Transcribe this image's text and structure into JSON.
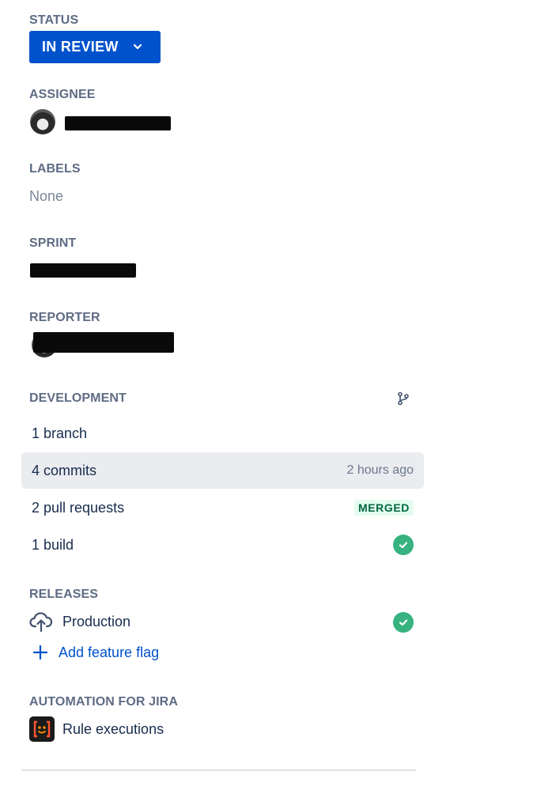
{
  "status": {
    "label": "STATUS",
    "value": "IN REVIEW",
    "color": "#0052cc"
  },
  "assignee": {
    "label": "ASSIGNEE"
  },
  "labels": {
    "label": "LABELS",
    "value": "None"
  },
  "sprint": {
    "label": "SPRINT"
  },
  "reporter": {
    "label": "REPORTER"
  },
  "development": {
    "label": "DEVELOPMENT",
    "icon": "branch-icon",
    "rows": [
      {
        "label": "1 branch"
      },
      {
        "label": "4 commits",
        "meta": "2 hours ago"
      },
      {
        "label": "2 pull requests",
        "badge": "MERGED"
      },
      {
        "label": "1 build",
        "status": "success"
      }
    ]
  },
  "releases": {
    "label": "RELEASES",
    "item": {
      "label": "Production",
      "icon": "cloud-upload-icon",
      "status": "success"
    },
    "add_flag": "Add feature flag"
  },
  "automation": {
    "label": "AUTOMATION FOR JIRA",
    "item": {
      "label": "Rule executions",
      "icon": "automation-icon"
    }
  },
  "colors": {
    "success": "#36b37e",
    "link": "#0052cc",
    "merged_bg": "#e3fcef",
    "merged_text": "#006644"
  }
}
